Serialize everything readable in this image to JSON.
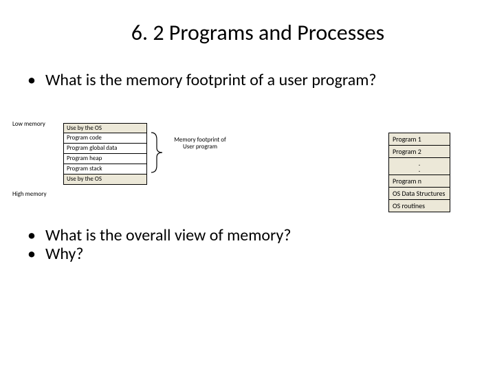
{
  "title": "6. 2 Programs and Processes",
  "bullets_top": [
    "What is the memory footprint of a user program?"
  ],
  "bullets_bottom": [
    "What is the overall view of memory?",
    "Why?"
  ],
  "diagram": {
    "low_label": "Low memory",
    "high_label": "High memory",
    "stack": [
      "Use by the OS",
      "Program code",
      "Program global data",
      "Program heap",
      "Program stack",
      "Use by the OS"
    ],
    "footprint_label": "Memory footprint of User program"
  },
  "right_stack": {
    "items_top": [
      "Program 1",
      "Program 2"
    ],
    "dots": ". .",
    "items_bottom": [
      "Program n",
      "OS Data Structures",
      "OS routines"
    ]
  }
}
